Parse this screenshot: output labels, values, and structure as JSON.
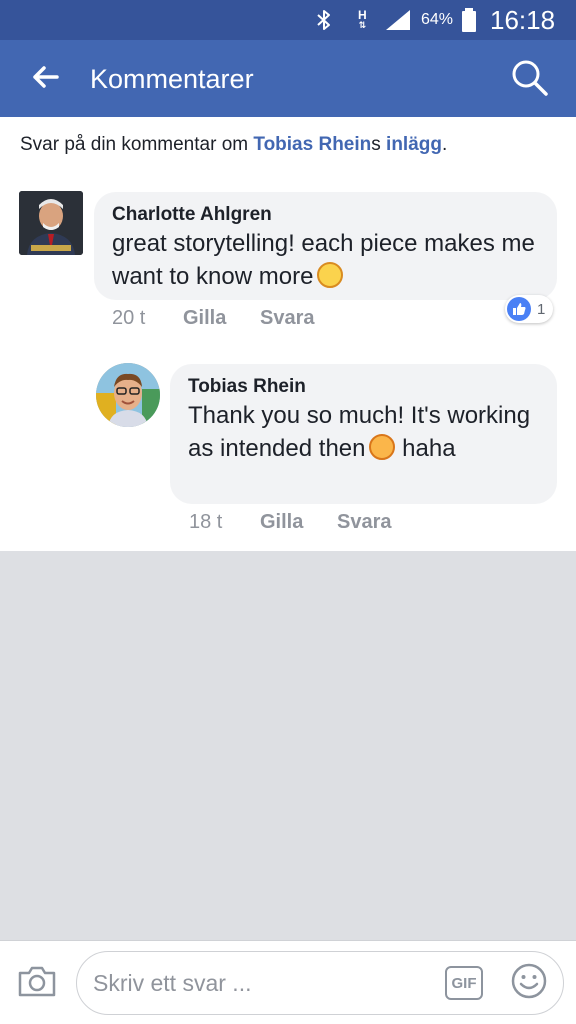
{
  "status_bar": {
    "network_label": "H",
    "battery_percent": "64%",
    "time": "16:18",
    "icons": [
      "bluetooth-icon",
      "network-h-icon",
      "signal-icon",
      "battery-icon"
    ]
  },
  "header": {
    "title": "Kommentarer",
    "back_icon": "arrow-left-icon",
    "search_icon": "search-icon",
    "background": "#4267b2"
  },
  "reply_context": {
    "prefix": "Svar på din kommentar om ",
    "author_link": "Tobias Rhein",
    "possessive": "s ",
    "post_link": "inlägg",
    "suffix": "."
  },
  "comments": [
    {
      "author": "Charlotte Ahlgren",
      "text": "great storytelling! each piece makes me want to know more",
      "emoji": "slightly-smiling-emoji",
      "time": "20 t",
      "like_label": "Gilla",
      "reply_label": "Svara",
      "reaction_count": "1",
      "reaction_icon": "thumbs-up-icon"
    },
    {
      "author": "Tobias Rhein",
      "text_before": "Thank you so much! It's working as intended then",
      "emoji": "tongue-out-emoji",
      "text_after": "haha",
      "time": "18 t",
      "like_label": "Gilla",
      "reply_label": "Svara"
    }
  ],
  "composer": {
    "placeholder": "Skriv ett svar ...",
    "gif_label": "GIF",
    "camera_icon": "camera-icon",
    "emoji_icon": "smiley-icon"
  },
  "colors": {
    "accent": "#4267b2",
    "status_bar": "#36549a",
    "bubble": "#f2f3f5",
    "meta_text": "#90949c",
    "like_blue": "#4a80f5"
  }
}
